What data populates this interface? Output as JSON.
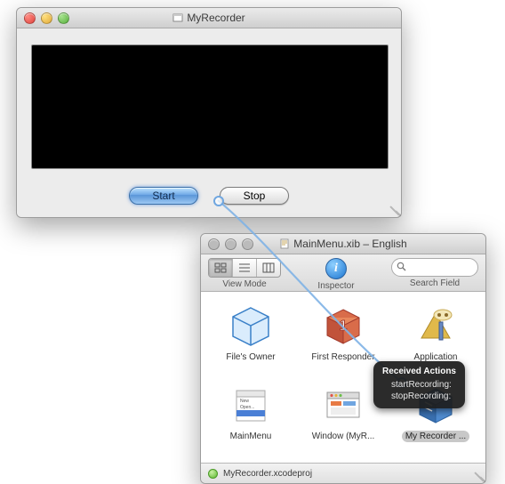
{
  "recorder": {
    "title": "MyRecorder",
    "start_label": "Start",
    "stop_label": "Stop"
  },
  "xib": {
    "title": "MainMenu.xib – English",
    "toolbar": {
      "view_mode_label": "View Mode",
      "inspector_label": "Inspector",
      "search_label": "Search Field",
      "search_placeholder": ""
    },
    "items": [
      {
        "label": "File's Owner",
        "icon": "cube"
      },
      {
        "label": "First Responder",
        "icon": "red-cube"
      },
      {
        "label": "Application",
        "icon": "app"
      },
      {
        "label": "MainMenu",
        "icon": "menu"
      },
      {
        "label": "Window (MyR...",
        "icon": "window"
      },
      {
        "label": "My Recorder ...",
        "icon": "controller"
      }
    ],
    "status_text": "MyRecorder.xcodeproj"
  },
  "hud": {
    "title": "Received Actions",
    "line1": "startRecording:",
    "line2": "stopRecording:"
  }
}
